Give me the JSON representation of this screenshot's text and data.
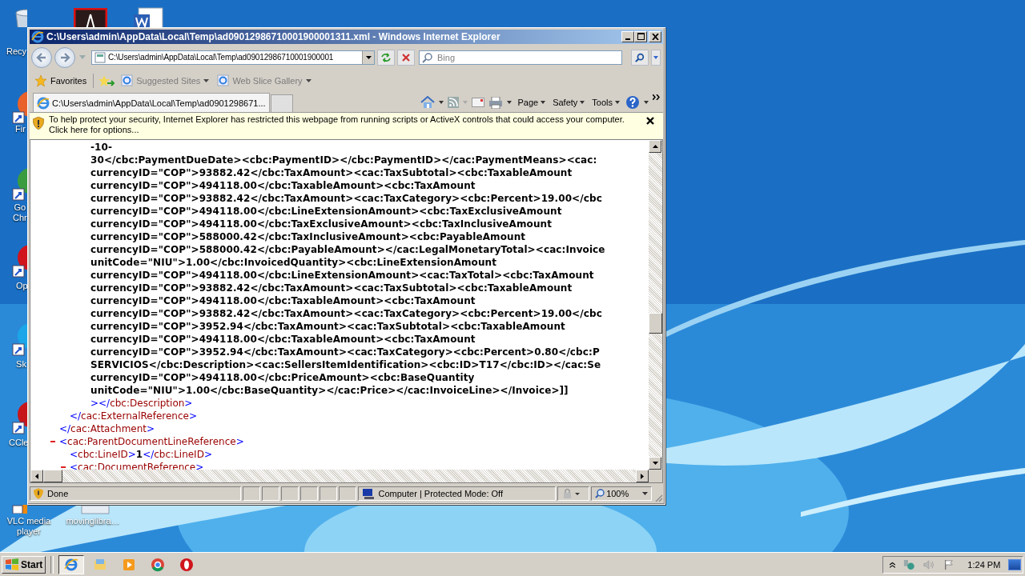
{
  "desktop": {
    "icons": [
      {
        "kind": "recycle",
        "label_lines": [
          "Recy"
        ]
      },
      {
        "kind": "pdf"
      },
      {
        "kind": "word"
      },
      {
        "kind": "firefox",
        "label_lines": [
          "Fir"
        ]
      },
      {
        "kind": "chrome",
        "label_lines": [
          "Go",
          "Chr"
        ]
      },
      {
        "kind": "opera",
        "label_lines": [
          "Op"
        ]
      },
      {
        "kind": "skype",
        "label_lines": [
          "Sk"
        ]
      },
      {
        "kind": "ccleaner",
        "label_lines": [
          "CCle"
        ]
      },
      {
        "kind": "vlc",
        "label_lines": [
          "VLC media",
          "player"
        ]
      },
      {
        "kind": "file",
        "label_lines": [
          "movinglibra…"
        ]
      }
    ]
  },
  "window": {
    "title": "C:\\Users\\admin\\AppData\\Local\\Temp\\ad09012986710001900001311.xml - Windows Internet Explorer",
    "address": "C:\\Users\\admin\\AppData\\Local\\Temp\\ad09012986710001900001",
    "search": {
      "placeholder": "Bing"
    },
    "favorites": {
      "label": "Favorites",
      "links": [
        {
          "label": "Suggested Sites",
          "disabled": true
        },
        {
          "label": "Web Slice Gallery",
          "disabled": true
        }
      ]
    },
    "tabs": [
      {
        "label": "C:\\Users\\admin\\AppData\\Local\\Temp\\ad0901298671...",
        "selected": true
      }
    ],
    "command_menus": [
      "Page",
      "Safety",
      "Tools"
    ],
    "info_bar": "To help protect your security, Internet Explorer has restricted this webpage from running scripts or ActiveX controls that could access your computer. Click here for options...",
    "xml": {
      "nodes": [
        {
          "close_tag": [
            "</",
            "cac:Attachment",
            ">"
          ],
          "children": [
            {
              "close_tag": [
                "</",
                "cac:ExternalReference",
                ">"
              ],
              "children": [
                {
                  "close_tag": [
                    "></",
                    "cbc:Description",
                    ">"
                  ],
                  "text_lines": [
                    "-10-",
                    "30</cbc:PaymentDueDate><cbc:PaymentID></cbc:PaymentID></cac:PaymentMeans><cac:",
                    "currencyID=\"COP\">93882.42</cbc:TaxAmount><cac:TaxSubtotal><cbc:TaxableAmount",
                    "currencyID=\"COP\">494118.00</cbc:TaxableAmount><cbc:TaxAmount",
                    "currencyID=\"COP\">93882.42</cbc:TaxAmount><cac:TaxCategory><cbc:Percent>19.00</cbc",
                    "currencyID=\"COP\">494118.00</cbc:LineExtensionAmount><cbc:TaxExclusiveAmount",
                    "currencyID=\"COP\">494118.00</cbc:TaxExclusiveAmount><cbc:TaxInclusiveAmount",
                    "currencyID=\"COP\">588000.42</cbc:TaxInclusiveAmount><cbc:PayableAmount",
                    "currencyID=\"COP\">588000.42</cbc:PayableAmount></cac:LegalMonetaryTotal><cac:Invoice",
                    "unitCode=\"NIU\">1.00</cbc:InvoicedQuantity><cbc:LineExtensionAmount",
                    "currencyID=\"COP\">494118.00</cbc:LineExtensionAmount><cac:TaxTotal><cbc:TaxAmount",
                    "currencyID=\"COP\">93882.42</cbc:TaxAmount><cac:TaxSubtotal><cbc:TaxableAmount",
                    "currencyID=\"COP\">494118.00</cbc:TaxableAmount><cbc:TaxAmount",
                    "currencyID=\"COP\">93882.42</cbc:TaxAmount><cac:TaxCategory><cbc:Percent>19.00</cbc",
                    "currencyID=\"COP\">3952.94</cbc:TaxAmount><cac:TaxSubtotal><cbc:TaxableAmount",
                    "currencyID=\"COP\">494118.00</cbc:TaxableAmount><cbc:TaxAmount",
                    "currencyID=\"COP\">3952.94</cbc:TaxAmount><cac:TaxCategory><cbc:Percent>0.80</cbc:P",
                    "SERVICIOS</cbc:Description><cac:SellersItemIdentification><cbc:ID>T17</cbc:ID></cac:Se",
                    "currencyID=\"COP\">494118.00</cbc:PriceAmount><cbc:BaseQuantity",
                    "unitCode=\"NIU\">1.00</cbc:BaseQuantity></cac:Price></cac:InvoiceLine></Invoice>]]"
                  ]
                }
              ]
            }
          ]
        },
        {
          "open_tag": [
            "<",
            "cac:ParentDocumentLineReference",
            ">"
          ],
          "collapsible": true,
          "children": [
            {
              "inline": [
                "<",
                "cbc:LineID",
                ">",
                "1",
                "</",
                "cbc:LineID",
                ">"
              ]
            },
            {
              "open_tag": [
                "<",
                "cac:DocumentReference",
                ">"
              ],
              "collapsible": true
            }
          ]
        }
      ]
    },
    "status": {
      "text": "Done",
      "zone": "Computer | Protected Mode: Off",
      "zoom": "100%"
    }
  },
  "taskbar": {
    "start": "Start",
    "apps": [
      {
        "kind": "ie",
        "selected": true
      },
      {
        "kind": "explorer",
        "selected": false
      },
      {
        "kind": "media",
        "selected": false
      },
      {
        "kind": "chrome",
        "selected": false
      },
      {
        "kind": "opera",
        "selected": false
      }
    ],
    "clock": "1:24 PM"
  }
}
